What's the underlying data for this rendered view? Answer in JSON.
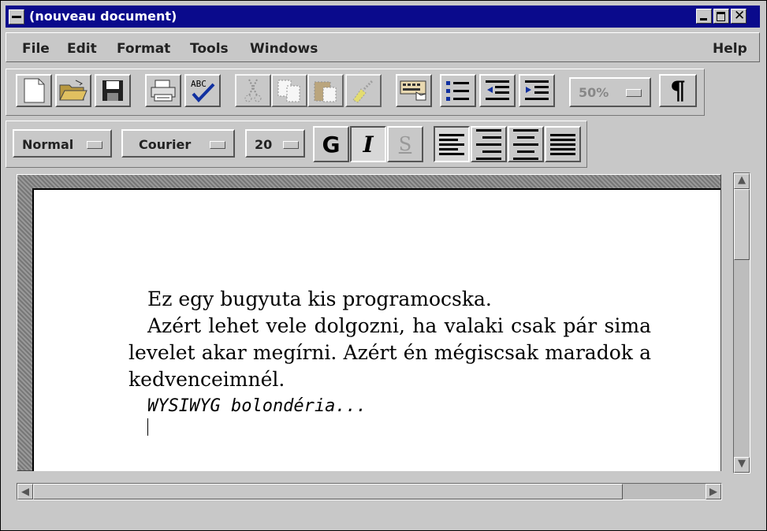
{
  "window": {
    "title": "(nouveau document)"
  },
  "menubar": {
    "items": [
      {
        "label": "File"
      },
      {
        "label": "Edit"
      },
      {
        "label": "Format"
      },
      {
        "label": "Tools"
      },
      {
        "label": "Windows"
      }
    ],
    "help": "Help"
  },
  "toolbar": {
    "icons": [
      "new-document-icon",
      "open-folder-icon",
      "save-disk-icon",
      "print-icon",
      "spellcheck-icon",
      "cut-scissors-icon",
      "copy-icon",
      "paste-icon",
      "format-brush-icon",
      "keyboard-icon",
      "bullet-list-icon",
      "outdent-icon",
      "indent-icon"
    ],
    "zoom": "50%",
    "pilcrow": "¶"
  },
  "format_bar": {
    "style": "Normal",
    "font": "Courier",
    "size": "20",
    "bold": "G",
    "italic": "I",
    "strike": "S"
  },
  "document": {
    "line1": "Ez egy bugyuta kis programocska.",
    "para2": "Azért lehet vele dolgozni, ha valaki csak pár sima levelet akar megírni. Azért én mégiscsak maradok a kedvenceimnél.",
    "line3": "WYSIWYG bolondéria..."
  },
  "colors": {
    "titlebar": "#0a0a8c",
    "chrome": "#c8c8c8"
  }
}
